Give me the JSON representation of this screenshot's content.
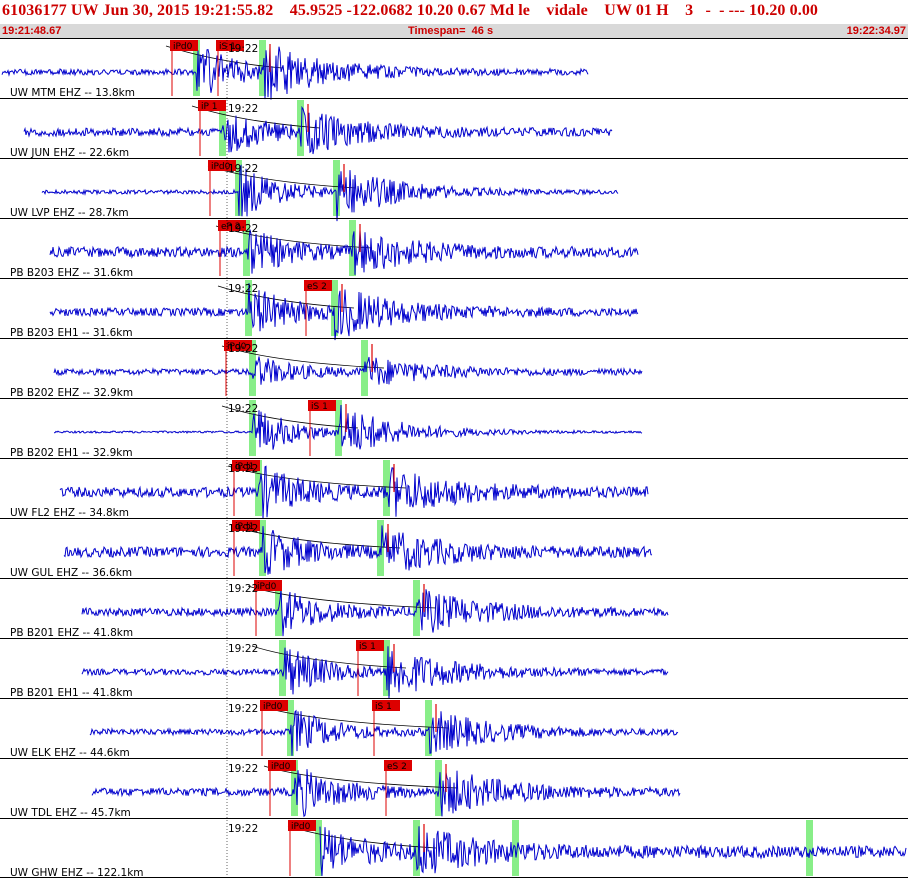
{
  "header": {
    "title": "61036177 UW Jun 30, 2015 19:21:55.82    45.9525 -122.0682 10.20 0.67 Md le    vidale    UW 01 H    3   -  - --- 10.20 0.00",
    "start_time": "19:21:48.67",
    "timespan": "Timespan=  46 s",
    "end_time": "19:22:34.97"
  },
  "colors": {
    "trace": "#0000cc",
    "pick": "#dd0000",
    "window": "#88ee88",
    "header_text": "#cc0000",
    "subbar": "#d9d9d9"
  },
  "channels": [
    {
      "label": "UW MTM EHZ -- 13.8km",
      "tick": "19:22",
      "picks": [
        "iPd0",
        "iS 1"
      ]
    },
    {
      "label": "UW JUN EHZ -- 22.6km",
      "tick": "19:22",
      "picks": [
        "iP 1"
      ]
    },
    {
      "label": "UW LVP EHZ -- 28.7km",
      "tick": "19:22",
      "picks": [
        "iPd0"
      ]
    },
    {
      "label": "PB B203 EHZ -- 31.6km",
      "tick": "19:22",
      "picks": [
        "eP 2"
      ]
    },
    {
      "label": "PB B203 EH1 -- 31.6km",
      "tick": "19:22",
      "picks": [
        "eS 2"
      ]
    },
    {
      "label": "PB B202 EHZ -- 32.9km",
      "tick": "19:22",
      "picks": [
        "iPd0"
      ]
    },
    {
      "label": "PB B202 EH1 -- 32.9km",
      "tick": "19:22",
      "picks": [
        "iS 1"
      ]
    },
    {
      "label": "UW FL2 EHZ -- 34.8km",
      "tick": "19:22",
      "picks": [
        "iPd1"
      ]
    },
    {
      "label": "UW GUL EHZ -- 36.6km",
      "tick": "19:22",
      "picks": [
        "iPd1"
      ]
    },
    {
      "label": "PB B201 EHZ -- 41.8km",
      "tick": "19:22",
      "picks": [
        "iPd0"
      ]
    },
    {
      "label": "PB B201 EH1 -- 41.8km",
      "tick": "19:22",
      "picks": [
        "iS 1"
      ]
    },
    {
      "label": "UW ELK EHZ -- 44.6km",
      "tick": "19:22",
      "picks": [
        "iPd0",
        "iS 1"
      ]
    },
    {
      "label": "UW TDL EHZ -- 45.7km",
      "tick": "19:22",
      "picks": [
        "iPd0",
        "eS 2"
      ]
    },
    {
      "label": "UW GHW EHZ -- 122.1km",
      "tick": "19:22",
      "picks": [
        "iPd0"
      ]
    }
  ]
}
